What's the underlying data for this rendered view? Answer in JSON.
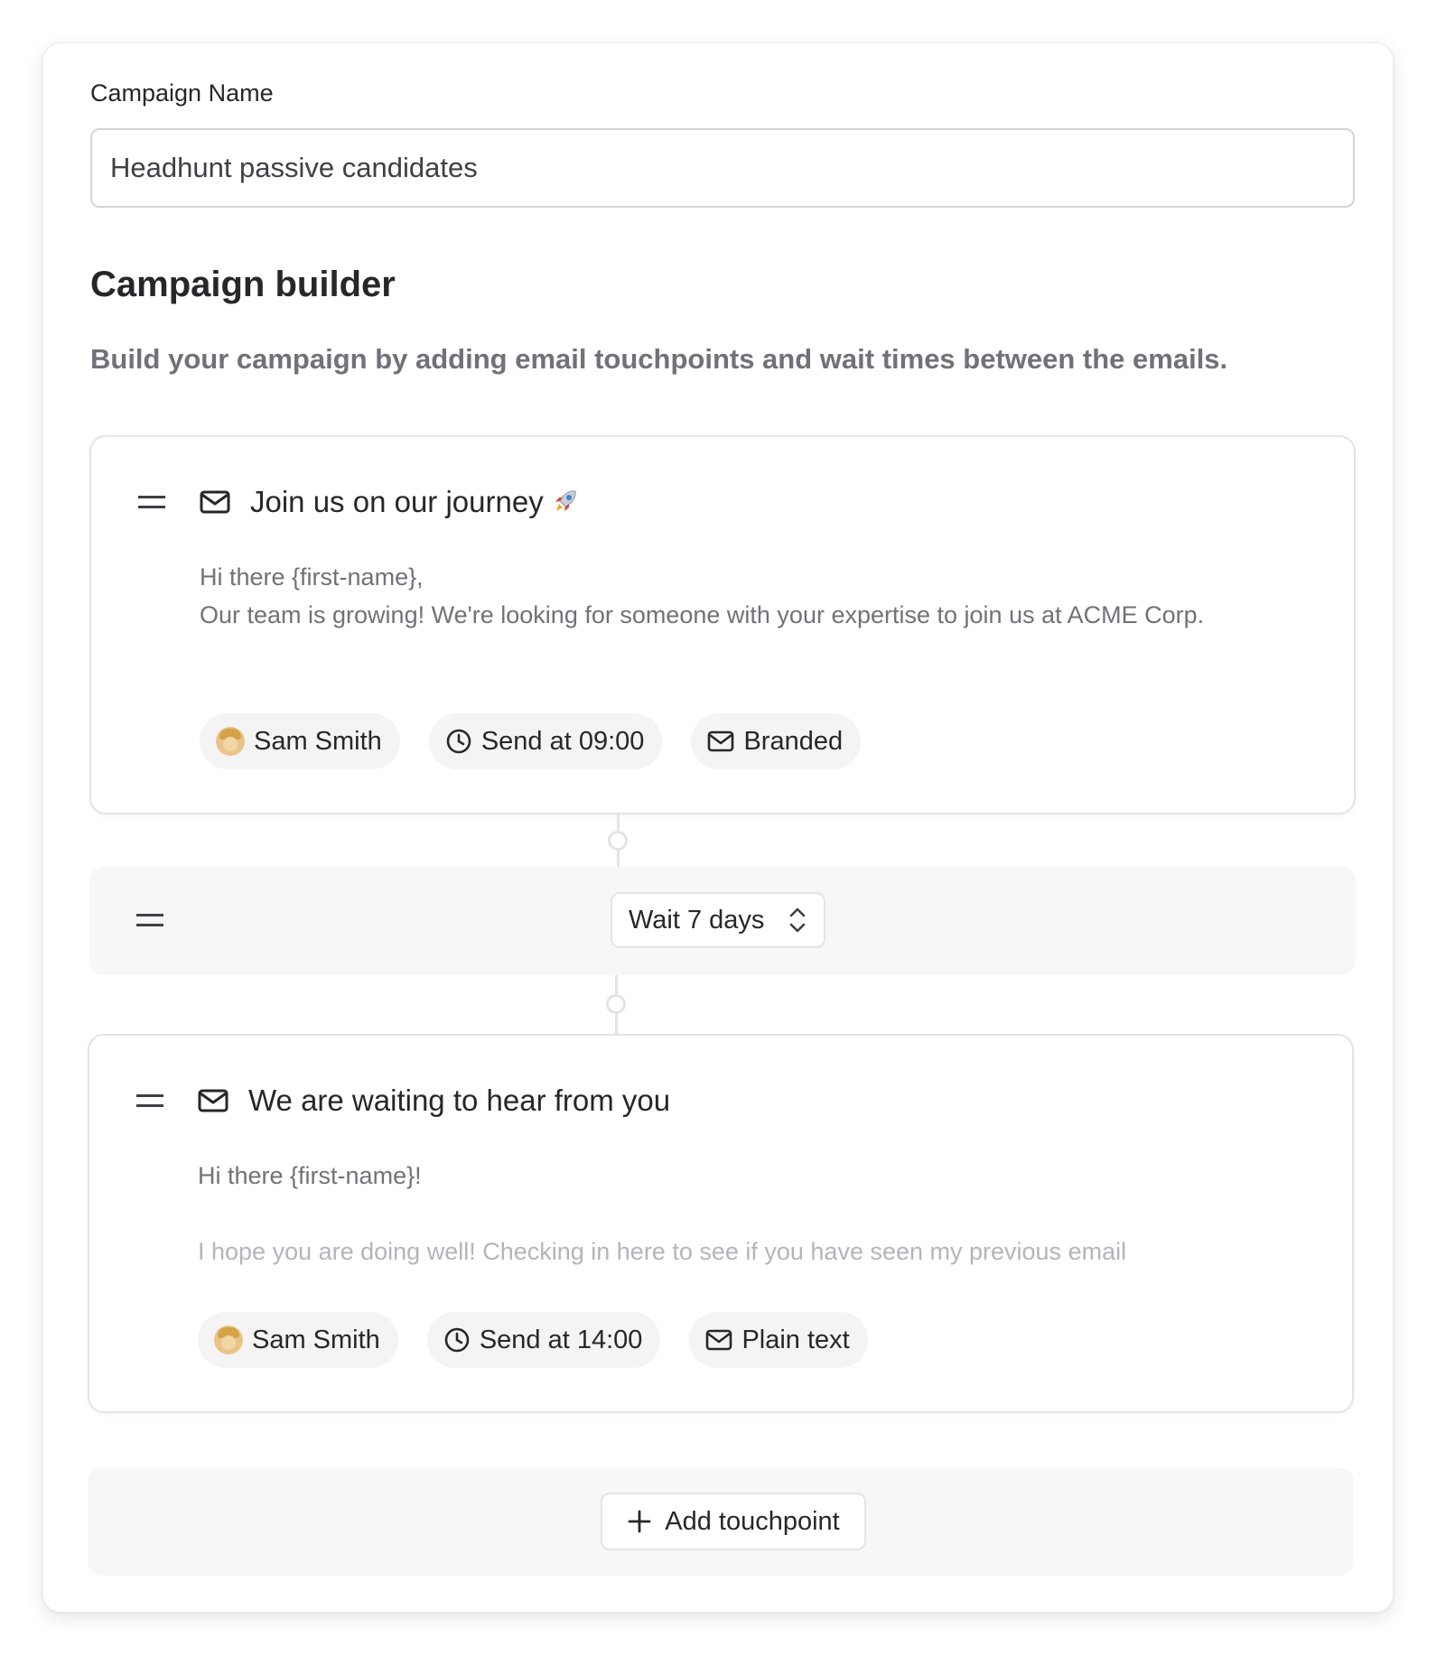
{
  "form": {
    "campaign_name_label": "Campaign Name",
    "campaign_name_value": "Headhunt passive candidates"
  },
  "builder": {
    "title": "Campaign builder",
    "description": "Build your campaign by adding email touchpoints and wait times between the emails."
  },
  "touchpoints": [
    {
      "subject": "Join us on our journey",
      "subject_emoji": "rocket-icon",
      "body_line1": "Hi there {first-name},",
      "body_line2": "Our team is growing! We're looking for someone with your expertise to join us at ACME Corp.",
      "sender": "Sam Smith",
      "send_time": "Send at 09:00",
      "format": "Branded"
    },
    {
      "subject": "We are waiting to hear from you",
      "body_line1": "Hi there {first-name}!",
      "body_line2": "I hope you are doing well! Checking in here to see if you have seen my previous email",
      "sender": "Sam Smith",
      "send_time": "Send at 14:00",
      "format": "Plain text"
    }
  ],
  "wait": {
    "label": "Wait 7 days"
  },
  "actions": {
    "add_touchpoint": "Add touchpoint"
  },
  "colors": {
    "text_primary": "#27272a",
    "text_muted": "#71717a",
    "border": "#e4e4e7",
    "chip_bg": "#f4f4f5",
    "block_bg": "#f7f7f8"
  }
}
